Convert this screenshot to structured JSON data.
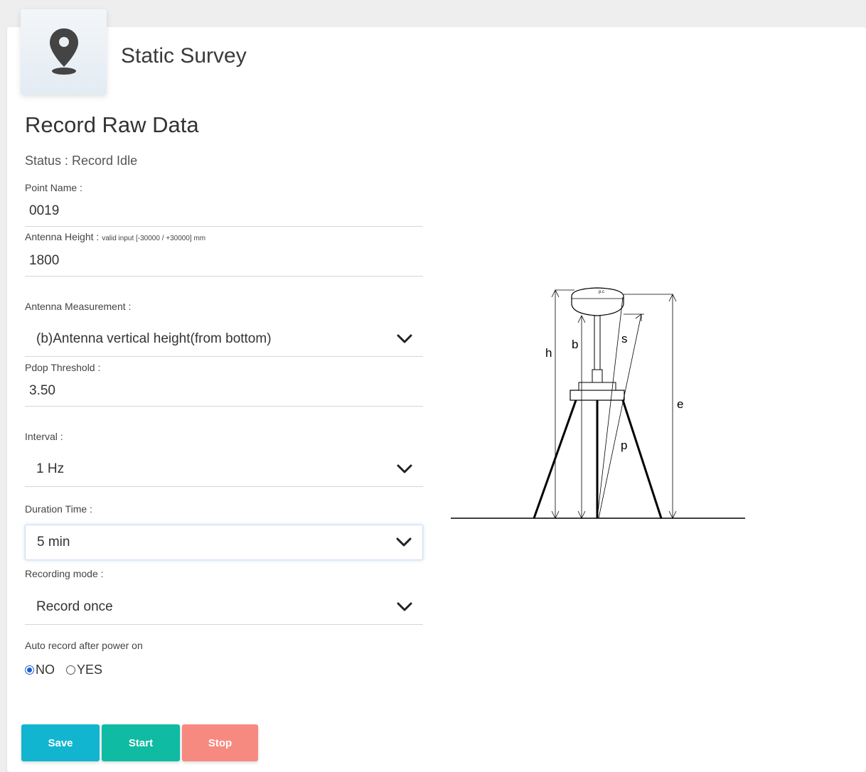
{
  "header": {
    "title": "Static Survey",
    "icon": "map-pin-icon"
  },
  "section": {
    "title": "Record Raw Data",
    "status": "Status : Record Idle"
  },
  "fields": {
    "point_name": {
      "label": "Point Name :",
      "value": "0019"
    },
    "antenna_height": {
      "label": "Antenna Height : ",
      "hint": "valid input [-30000 / +30000] mm",
      "value": "1800"
    },
    "antenna_measurement": {
      "label": "Antenna Measurement :",
      "value": "(b)Antenna vertical height(from bottom)"
    },
    "pdop_threshold": {
      "label": "Pdop Threshold :",
      "value": "3.50"
    },
    "interval": {
      "label": "Interval :",
      "value": "1 Hz"
    },
    "duration_time": {
      "label": "Duration Time :",
      "value": "5 min"
    },
    "recording_mode": {
      "label": "Recording mode :",
      "value": "Record once"
    },
    "auto_record": {
      "label": "Auto record after power on",
      "options": [
        "NO",
        "YES"
      ],
      "selected": "NO"
    }
  },
  "buttons": {
    "save": "Save",
    "start": "Start",
    "stop": "Stop"
  },
  "diagram": {
    "labels": {
      "h": "h",
      "b": "b",
      "s": "s",
      "e": "e",
      "p": "p",
      "pc": "p.c"
    }
  },
  "colors": {
    "save": "#12b5d0",
    "start": "#0fbba3",
    "stop": "#f78a80",
    "radio_selected": "#1a5fd6"
  }
}
